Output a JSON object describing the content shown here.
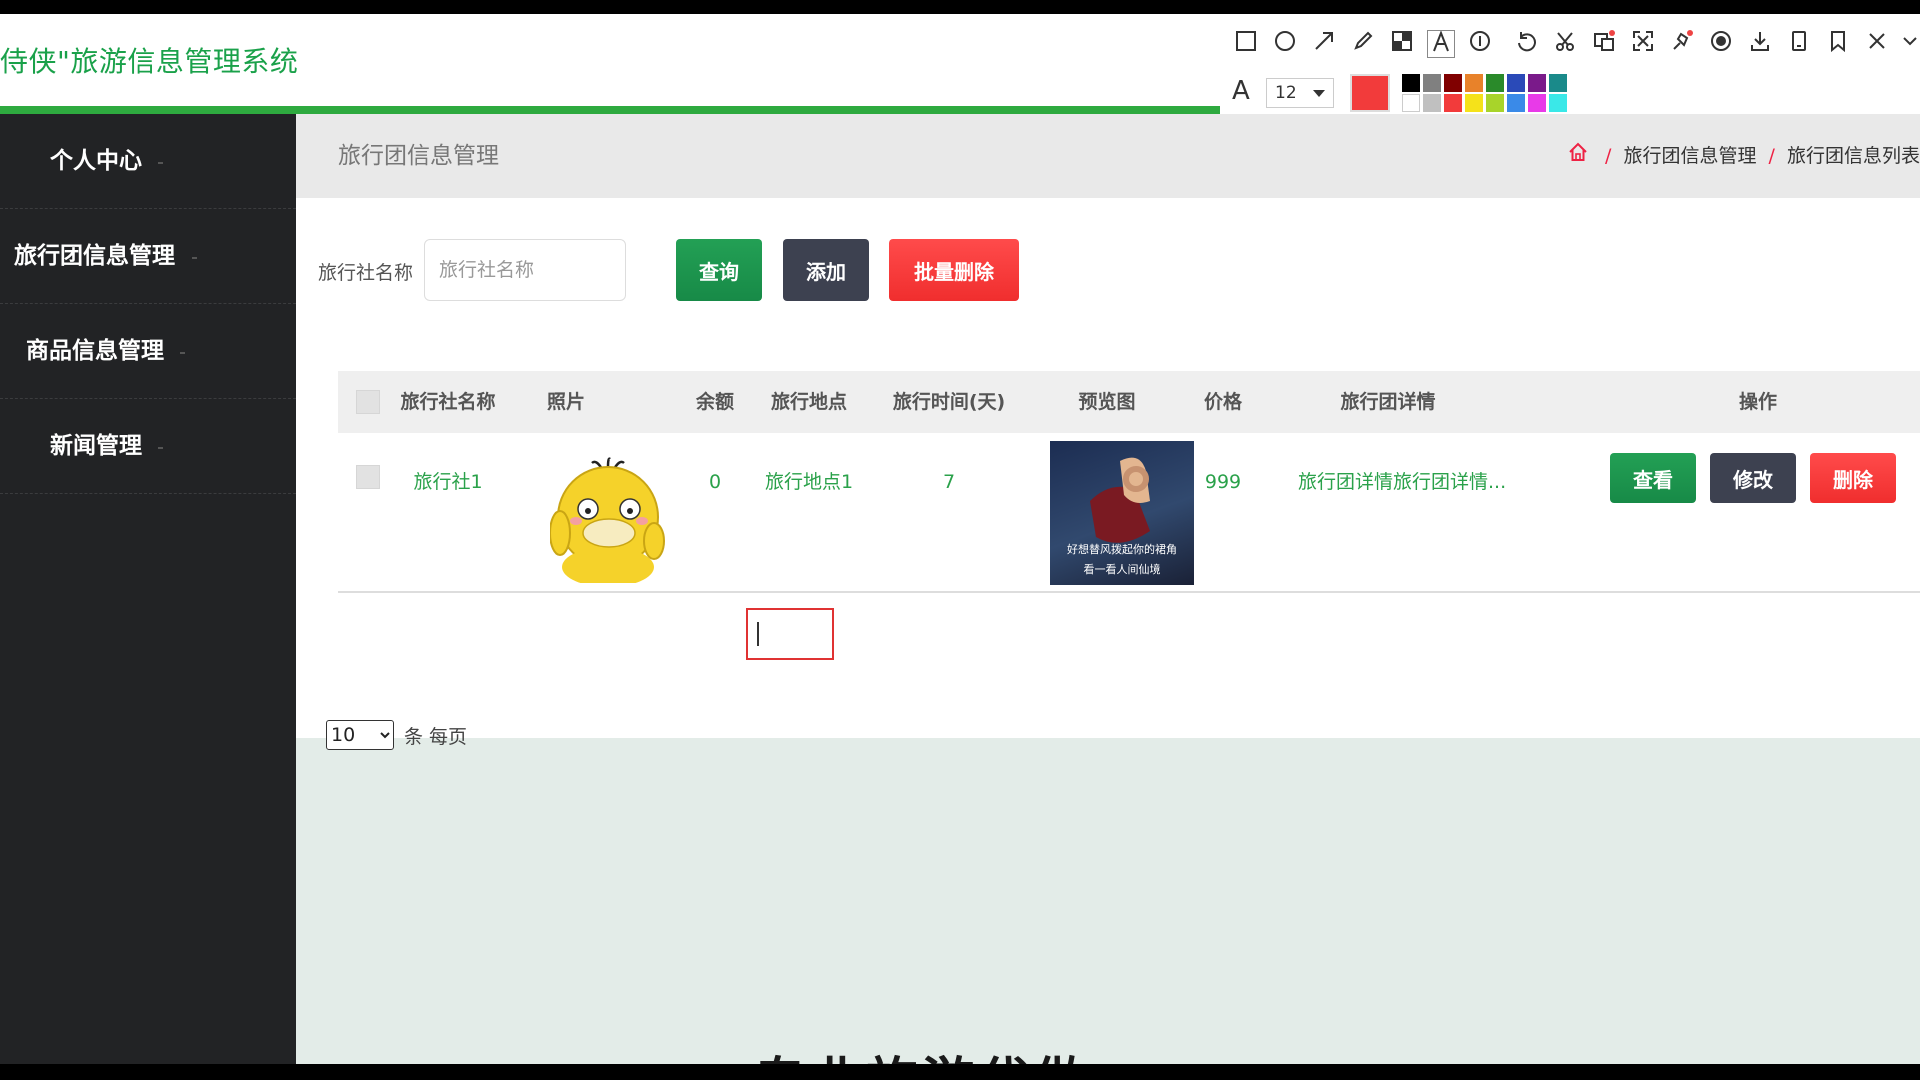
{
  "app": {
    "title": "侍侠\"旅游信息管理系统"
  },
  "sidebar": {
    "items": [
      {
        "label": "个人中心"
      },
      {
        "label": "旅行团信息管理"
      },
      {
        "label": "商品信息管理"
      },
      {
        "label": "新闻管理"
      }
    ]
  },
  "page": {
    "title": "旅行团信息管理",
    "breadcrumb": [
      "旅行团信息管理",
      "旅行团信息列表"
    ]
  },
  "search": {
    "label": "旅行社名称",
    "placeholder": "旅行社名称",
    "value": "",
    "query_label": "查询",
    "add_label": "添加",
    "batch_delete_label": "批量删除"
  },
  "table": {
    "columns": [
      "旅行社名称",
      "照片",
      "余额",
      "旅行地点",
      "旅行时间(天)",
      "预览图",
      "价格",
      "旅行团详情",
      "操作"
    ],
    "rows": [
      {
        "agency": "旅行社1",
        "balance": "0",
        "location": "旅行地点1",
        "days": "7",
        "preview_caption_1": "好想替风拨起你的裙角",
        "preview_caption_2": "看一看人间仙境",
        "price": "999",
        "details": "旅行团详情旅行团详情...",
        "view_label": "查看",
        "edit_label": "修改",
        "delete_label": "删除"
      }
    ]
  },
  "pagination": {
    "page_size": "10",
    "options": [
      "10"
    ],
    "unit": "条 每页"
  },
  "overlay": {
    "font_size": "12",
    "bottom_text": "专业旅游代做"
  },
  "colors": {
    "accent": "#1aa14a",
    "sidebar": "#222325",
    "danger": "#f23b3b",
    "dark": "#3d4150"
  }
}
